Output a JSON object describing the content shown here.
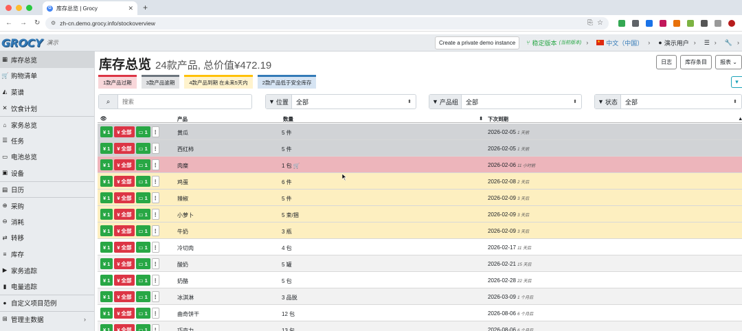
{
  "browser": {
    "tab_title": "库存总览 | Grocy",
    "url": "zh-cn.demo.grocy.info/stockoverview"
  },
  "header": {
    "logo": "GROCY",
    "demo_label": "演示",
    "demo_button": "Create a private demo instance",
    "version": "稳定版本",
    "version_sub": "(当前版本)",
    "language": "中文（中国）",
    "user": "演示用户"
  },
  "sidebar": {
    "items": [
      {
        "label": "库存总览",
        "icon": "box-icon"
      },
      {
        "label": "购物清单",
        "icon": "cart-icon"
      },
      {
        "label": "菜谱",
        "icon": "pizza-icon"
      },
      {
        "label": "饮食计划",
        "icon": "utensils-icon"
      },
      {
        "label": "家务总览",
        "icon": "home-icon"
      },
      {
        "label": "任务",
        "icon": "tasks-icon"
      },
      {
        "label": "电池总览",
        "icon": "battery-icon"
      },
      {
        "label": "设备",
        "icon": "device-icon"
      },
      {
        "label": "日历",
        "icon": "calendar-icon"
      },
      {
        "label": "采购",
        "icon": "cart-plus-icon"
      },
      {
        "label": "消耗",
        "icon": "consume-icon"
      },
      {
        "label": "转移",
        "icon": "transfer-icon"
      },
      {
        "label": "库存",
        "icon": "list-icon"
      },
      {
        "label": "家务追踪",
        "icon": "play-icon"
      },
      {
        "label": "电量追踪",
        "icon": "battery-track-icon"
      },
      {
        "label": "自定义项目范例",
        "icon": "custom-icon"
      },
      {
        "label": "管理主数据",
        "icon": "table-icon"
      }
    ]
  },
  "main": {
    "title": "库存总览",
    "subtitle": "24款产品, 总价值¥472.19",
    "buttons": {
      "journal": "日志",
      "entries": "库存条目",
      "reports": "报表"
    },
    "badges": [
      {
        "label": "1款产品过期",
        "color": "#dc3545",
        "bg": "#f8d7da"
      },
      {
        "label": "3款产品逾期",
        "color": "#6c757d",
        "bg": "#e2e3e5"
      },
      {
        "label": "4款产品到期 在未来5天内",
        "color": "#ffc107",
        "bg": "#fff3cd"
      },
      {
        "label": "2款产品低于安全库存",
        "color": "#337ab7",
        "bg": "#d6e4f3"
      }
    ],
    "search_placeholder": "搜索",
    "filters": {
      "location_label": "位置",
      "location_value": "全部",
      "group_label": "产品组",
      "group_value": "全部",
      "status_label": "状态",
      "status_value": "全部"
    },
    "columns": {
      "product": "产品",
      "amount": "数量",
      "due": "下次到期"
    },
    "action_labels": {
      "consume": "1",
      "consume_all": "全部",
      "open": "1"
    },
    "rows": [
      {
        "product": "黄瓜",
        "amount": "5 件",
        "date": "2026-02-05",
        "rel": "1 天前",
        "bg": "grey"
      },
      {
        "product": "西红柿",
        "amount": "5 件",
        "date": "2026-02-05",
        "rel": "1 天前",
        "bg": "grey"
      },
      {
        "product": "肉糜",
        "amount": "1 包",
        "date": "2026-02-06",
        "rel": "11 小时前",
        "bg": "red",
        "cart": true
      },
      {
        "product": "鸡蛋",
        "amount": "6 件",
        "date": "2026-02-08",
        "rel": "2 天后",
        "bg": "yel"
      },
      {
        "product": "辣椒",
        "amount": "5 件",
        "date": "2026-02-09",
        "rel": "3 天后",
        "bg": "yel"
      },
      {
        "product": "小萝卜",
        "amount": "5 束/捆",
        "date": "2026-02-09",
        "rel": "3 天后",
        "bg": "yel"
      },
      {
        "product": "牛奶",
        "amount": "3 瓶",
        "date": "2026-02-09",
        "rel": "3 天后",
        "bg": "yel"
      },
      {
        "product": "冷切肉",
        "amount": "4 包",
        "date": "2026-02-17",
        "rel": "11 天后",
        "bg": "wht"
      },
      {
        "product": "酸奶",
        "amount": "5 罐",
        "date": "2026-02-21",
        "rel": "15 天后",
        "bg": "alt"
      },
      {
        "product": "奶酪",
        "amount": "5 包",
        "date": "2026-02-28",
        "rel": "22 天后",
        "bg": "wht"
      },
      {
        "product": "冰淇淋",
        "amount": "3 品脱",
        "date": "2026-03-09",
        "rel": "1 个月后",
        "bg": "alt"
      },
      {
        "product": "曲奇饼干",
        "amount": "12 包",
        "date": "2026-08-06",
        "rel": "6 个月后",
        "bg": "wht"
      },
      {
        "product": "巧克力",
        "amount": "13 包",
        "date": "2026-08-06",
        "rel": "6 个月后",
        "bg": "alt"
      }
    ]
  }
}
